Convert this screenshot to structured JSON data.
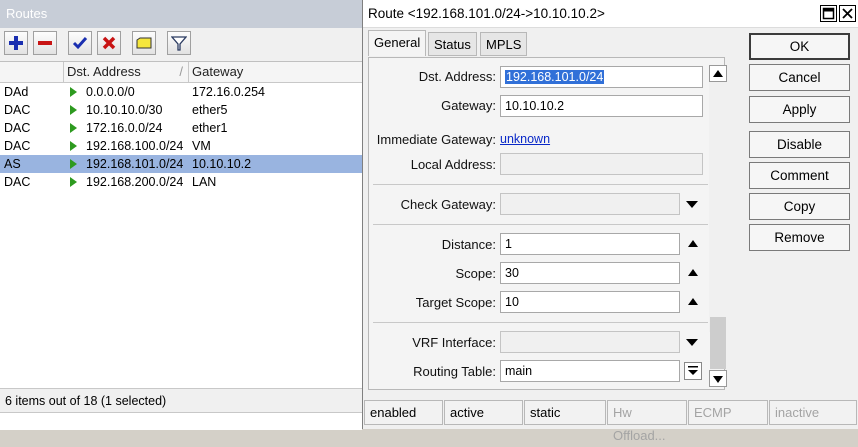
{
  "routes_window": {
    "title": "Routes",
    "columns": [
      "",
      "Dst. Address",
      "Gateway"
    ],
    "rows": [
      {
        "flags": "DAd",
        "dst": "0.0.0.0/0",
        "gateway": "172.16.0.254",
        "selected": false
      },
      {
        "flags": "DAC",
        "dst": "10.10.10.0/30",
        "gateway": "ether5",
        "selected": false
      },
      {
        "flags": "DAC",
        "dst": "172.16.0.0/24",
        "gateway": "ether1",
        "selected": false
      },
      {
        "flags": "DAC",
        "dst": "192.168.100.0/24",
        "gateway": "VM",
        "selected": false
      },
      {
        "flags": "AS",
        "dst": "192.168.101.0/24",
        "gateway": "10.10.10.2",
        "selected": true
      },
      {
        "flags": "DAC",
        "dst": "192.168.200.0/24",
        "gateway": "LAN",
        "selected": false
      }
    ],
    "status": "6 items out of 18 (1 selected)",
    "toolbar_icons": [
      "add-icon",
      "remove-icon",
      "enable-icon",
      "disable-icon",
      "comment-icon",
      "filter-icon"
    ],
    "colors": {
      "title_bar": "#c7cdd7",
      "selected_row": "#99b4e0",
      "arrow": "#2d9a1f"
    }
  },
  "dialog": {
    "title": "Route <192.168.101.0/24->10.10.10.2>",
    "tabs": [
      "General",
      "Status",
      "MPLS"
    ],
    "active_tab": "General",
    "fields": {
      "dst_address": {
        "label": "Dst. Address:",
        "value": "192.168.101.0/24"
      },
      "gateway": {
        "label": "Gateway:",
        "value": "10.10.10.2"
      },
      "immediate_gateway": {
        "label": "Immediate Gateway:",
        "value": "unknown"
      },
      "local_address": {
        "label": "Local Address:",
        "value": ""
      },
      "check_gateway": {
        "label": "Check Gateway:",
        "value": ""
      },
      "distance": {
        "label": "Distance:",
        "value": "1"
      },
      "scope": {
        "label": "Scope:",
        "value": "30"
      },
      "target_scope": {
        "label": "Target Scope:",
        "value": "10"
      },
      "vrf_interface": {
        "label": "VRF Interface:",
        "value": ""
      },
      "routing_table": {
        "label": "Routing Table:",
        "value": "main"
      }
    },
    "buttons": {
      "ok": "OK",
      "cancel": "Cancel",
      "apply": "Apply",
      "disable": "Disable",
      "comment": "Comment",
      "copy": "Copy",
      "remove": "Remove"
    },
    "status_bar": [
      "enabled",
      "active",
      "static",
      "Hw Offload...",
      "ECMP",
      "inactive"
    ],
    "colors": {
      "link": "#0a29c8",
      "selection": "#3170d8"
    }
  }
}
